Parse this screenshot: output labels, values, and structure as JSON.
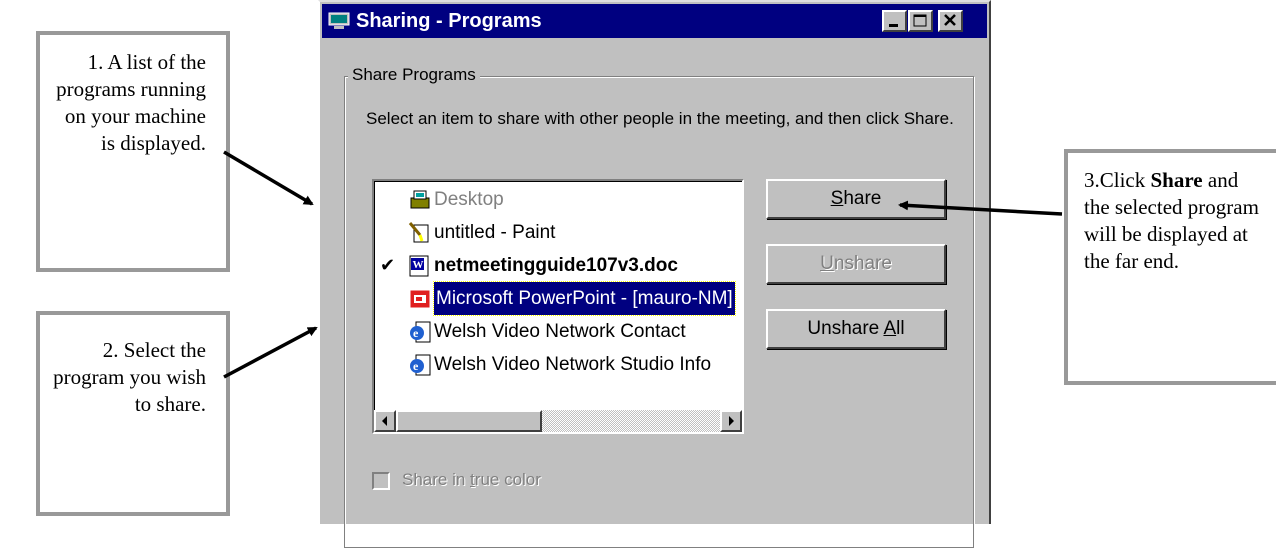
{
  "callouts": {
    "c1": "1. A list of the programs running on your machine is displayed.",
    "c2": "2. Select the program you wish to share.",
    "c3_pre": "3.Click ",
    "c3_bold": "Share",
    "c3_post": " and the selected program will be displayed at the far end."
  },
  "window": {
    "title": "Sharing - Programs",
    "group_label": "Share Programs",
    "instructions": "Select an item to share with other people in the meeting, and then click Share."
  },
  "list": {
    "items": [
      {
        "label": "Desktop",
        "icon": "desktop-icon",
        "state": "dim",
        "checked": ""
      },
      {
        "label": "untitled - Paint",
        "icon": "paint-icon",
        "state": "normal",
        "checked": ""
      },
      {
        "label": "netmeetingguide107v3.doc",
        "icon": "word-icon",
        "state": "bold",
        "checked": "✔"
      },
      {
        "label": "Microsoft PowerPoint - [mauro-NM]",
        "icon": "powerpoint-icon",
        "state": "selected",
        "checked": ""
      },
      {
        "label": "Welsh Video Network Contact",
        "icon": "ie-icon",
        "state": "normal",
        "checked": ""
      },
      {
        "label": "Welsh Video Network Studio Info",
        "icon": "ie-icon",
        "state": "normal",
        "checked": ""
      }
    ]
  },
  "buttons": {
    "share": "Share",
    "unshare": "Unshare",
    "unshare_all": "Unshare All"
  },
  "truecolor_label": "Share in true color",
  "colors": {
    "titlebar": "#000080",
    "window": "#c0c0c0",
    "callout_border": "#999999"
  }
}
